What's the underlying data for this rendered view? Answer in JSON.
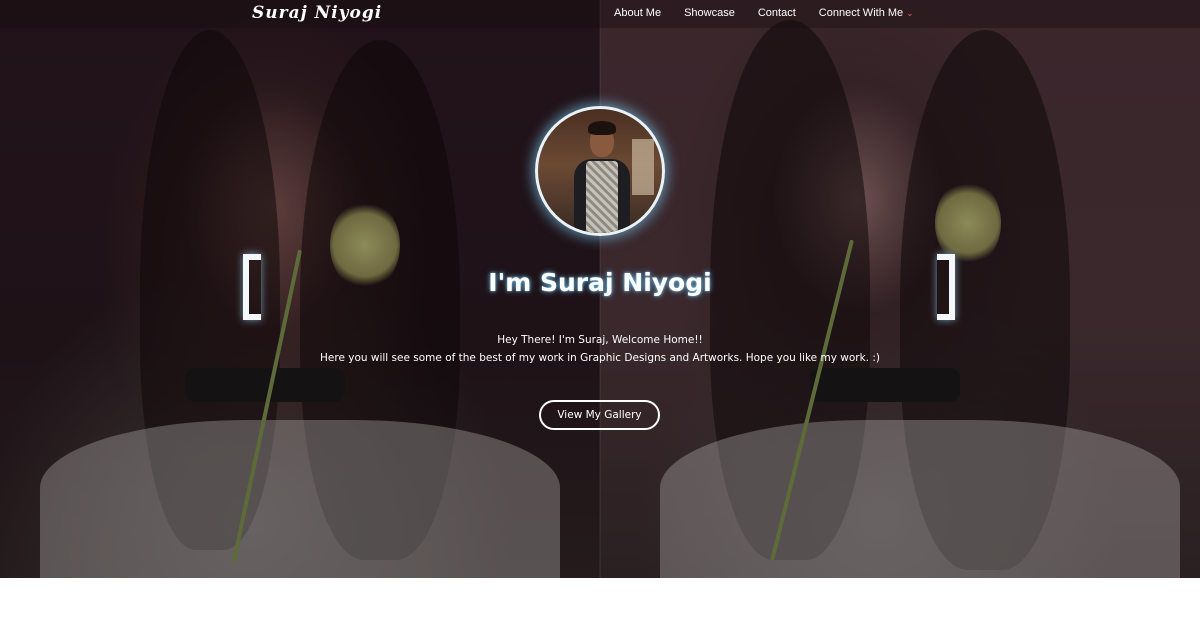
{
  "navbar": {
    "brand": "Suraj Niyogi",
    "links": [
      {
        "label": "About Me"
      },
      {
        "label": "Showcase"
      },
      {
        "label": "Contact"
      },
      {
        "label": "Connect With Me",
        "dropdown": true
      }
    ],
    "dropdown_icon": "chevron-down-icon",
    "accent_color": "#e0634f"
  },
  "hero": {
    "headline": "I'm Suraj Niyogi",
    "intro_line1": "Hey There! I'm Suraj, Welcome Home!!",
    "intro_line2": "Here you will see some of the best of my work in Graphic Designs and Artworks. Hope you like my work. :)",
    "cta_label": "View My Gallery",
    "glow_color": "#78c8f0"
  }
}
